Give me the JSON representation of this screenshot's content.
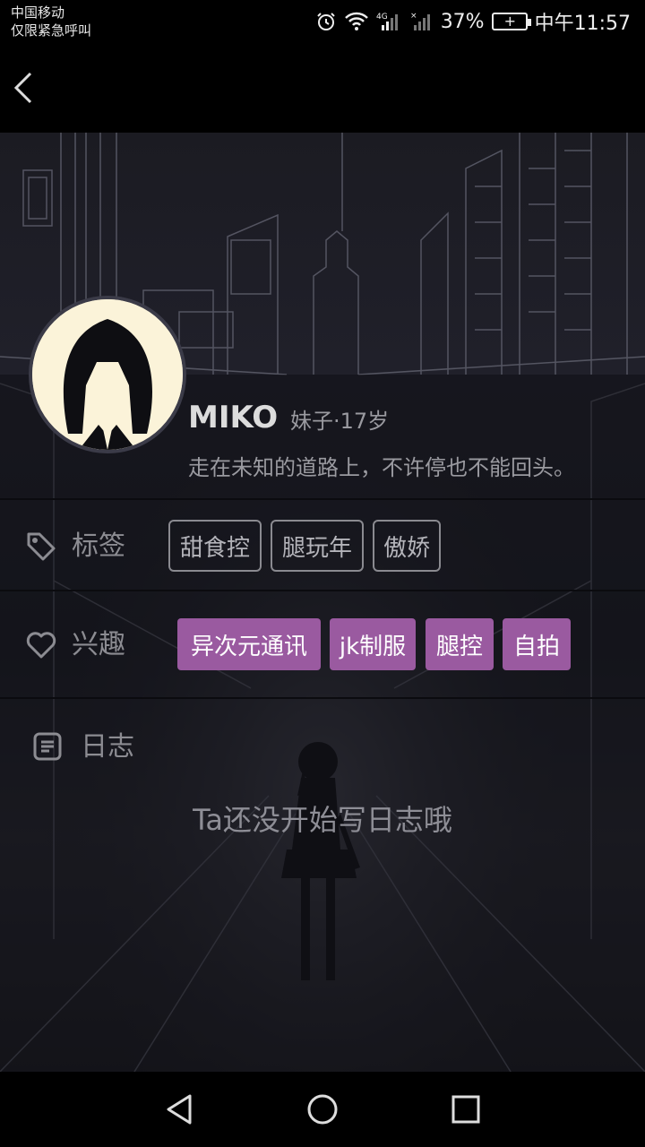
{
  "status_bar": {
    "carrier": "中国移动",
    "carrier_note": "仅限紧急呼叫",
    "battery": "37%",
    "time": "中午11:57",
    "icons": [
      "alarm-icon",
      "wifi-icon",
      "signal-4g-icon",
      "signal-icon",
      "battery-icon"
    ]
  },
  "profile": {
    "name": "MIKO",
    "meta": "妹子·17岁",
    "motto": "走在未知的道路上，不许停也不能回头。"
  },
  "tags": {
    "label": "标签",
    "items": [
      "甜食控",
      "腿玩年",
      "傲娇"
    ]
  },
  "interests": {
    "label": "兴趣",
    "items": [
      "异次元通讯",
      "jk制服",
      "腿控",
      "自拍"
    ],
    "accent_color": "#9a5aa0"
  },
  "diary": {
    "label": "日志",
    "empty_text": "Ta还没开始写日志哦"
  },
  "colors": {
    "background": "#1b1b22",
    "chip_border": "#8a8a90",
    "text_muted": "#9a9aa0"
  }
}
